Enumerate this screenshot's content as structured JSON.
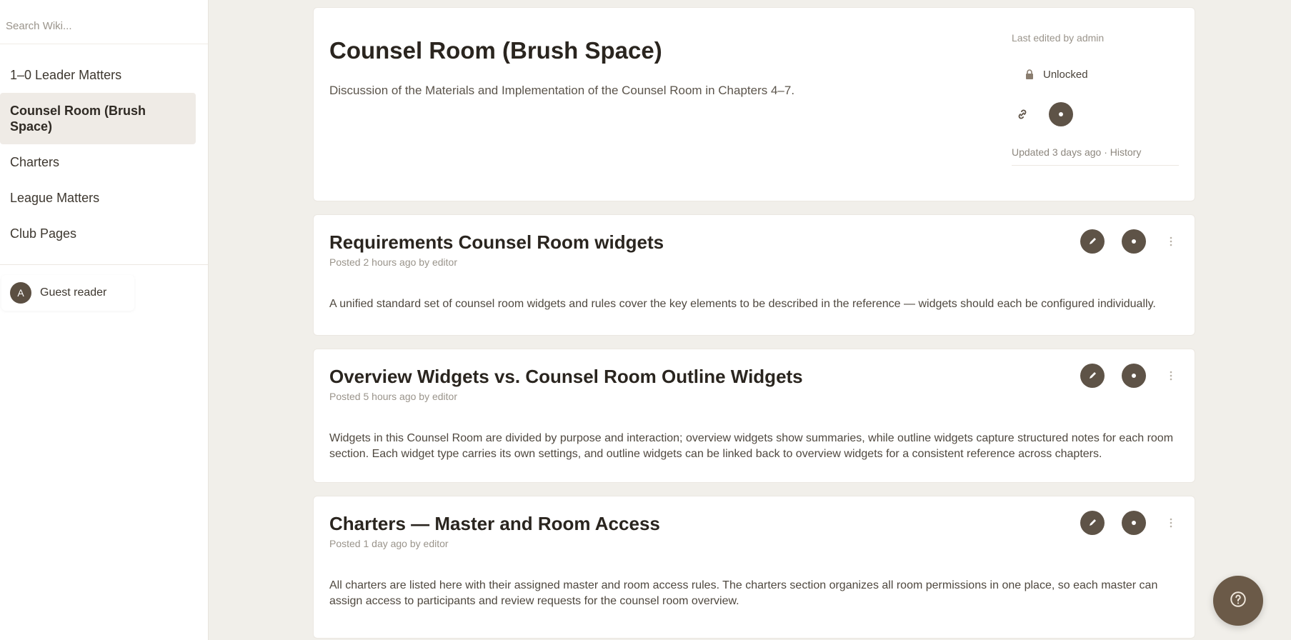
{
  "sidebar": {
    "search_placeholder": "Search Wiki...",
    "items": [
      {
        "label": "1–0 Leader Matters"
      },
      {
        "label": "Counsel Room (Brush Space)"
      },
      {
        "label": "Charters"
      },
      {
        "label": "League Matters"
      },
      {
        "label": "Club Pages"
      }
    ],
    "user": {
      "initial": "A",
      "name": "Guest reader"
    }
  },
  "header": {
    "title": "Counsel Room (Brush Space)",
    "subtitle": "Discussion of the Materials and Implementation of the Counsel Room in Chapters 4–7.",
    "meta": "Last edited by admin",
    "status_label": "Unlocked",
    "footer_text": "Updated 3 days ago · History"
  },
  "sections": [
    {
      "title": "Requirements Counsel Room widgets",
      "meta": "Posted 2 hours ago by editor",
      "body": "A unified standard set of counsel room widgets and rules cover the key elements to be described in the reference — widgets should each be configured individually."
    },
    {
      "title": "Overview Widgets vs. Counsel Room Outline Widgets",
      "meta": "Posted 5 hours ago by editor",
      "body": "Widgets in this Counsel Room are divided by purpose and interaction; overview widgets show summaries, while outline widgets capture structured notes for each room section. Each widget type carries its own settings, and outline widgets can be linked back to overview widgets for a consistent reference across chapters."
    },
    {
      "title": "Charters — Master and Room Access",
      "meta": "Posted 1 day ago by editor",
      "body": "All charters are listed here with their assigned master and room access rules. The charters section organizes all room permissions in one place, so each master can assign access to participants and review requests for the counsel room overview."
    }
  ],
  "colors": {
    "accent": "#6b5a48",
    "background": "#f1efea",
    "card": "#ffffff"
  },
  "icons": [
    "lock-icon",
    "link-icon",
    "settings-icon",
    "edit-icon",
    "more-icon",
    "help-icon"
  ]
}
